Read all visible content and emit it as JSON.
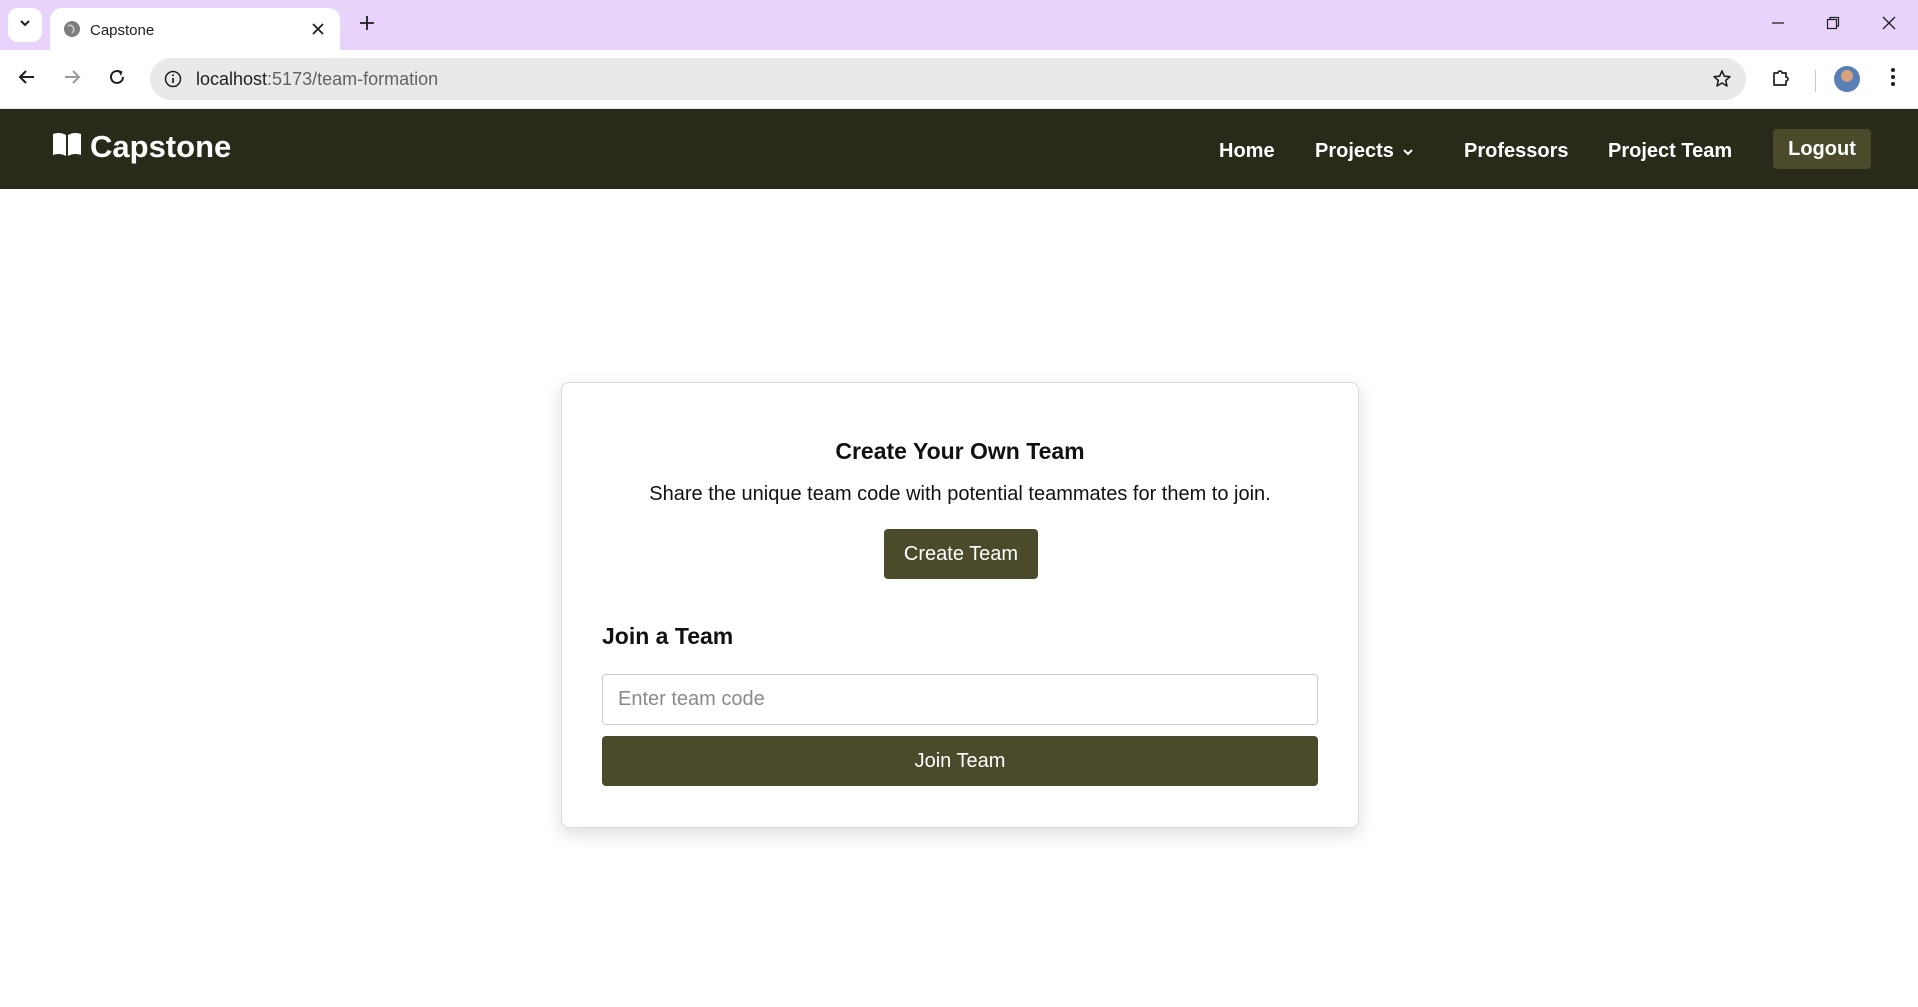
{
  "browser": {
    "tab": {
      "title": "Capstone"
    },
    "url": {
      "host": "localhost",
      "path": ":5173/team-formation"
    }
  },
  "navbar": {
    "brand": "Capstone",
    "links": [
      {
        "label": "Home"
      },
      {
        "label": "Projects"
      },
      {
        "label": "Professors"
      },
      {
        "label": "Project Team"
      }
    ],
    "logout_label": "Logout"
  },
  "card": {
    "create": {
      "title": "Create Your Own Team",
      "description": "Share the unique team code with potential teammates for them to join.",
      "button_label": "Create Team"
    },
    "join": {
      "title": "Join a Team",
      "input_placeholder": "Enter team code",
      "input_value": "",
      "button_label": "Join Team"
    }
  },
  "colors": {
    "navbar_bg": "#2a2a1a",
    "accent": "#4b4a2b",
    "tabstrip": "#e8d3fb"
  }
}
